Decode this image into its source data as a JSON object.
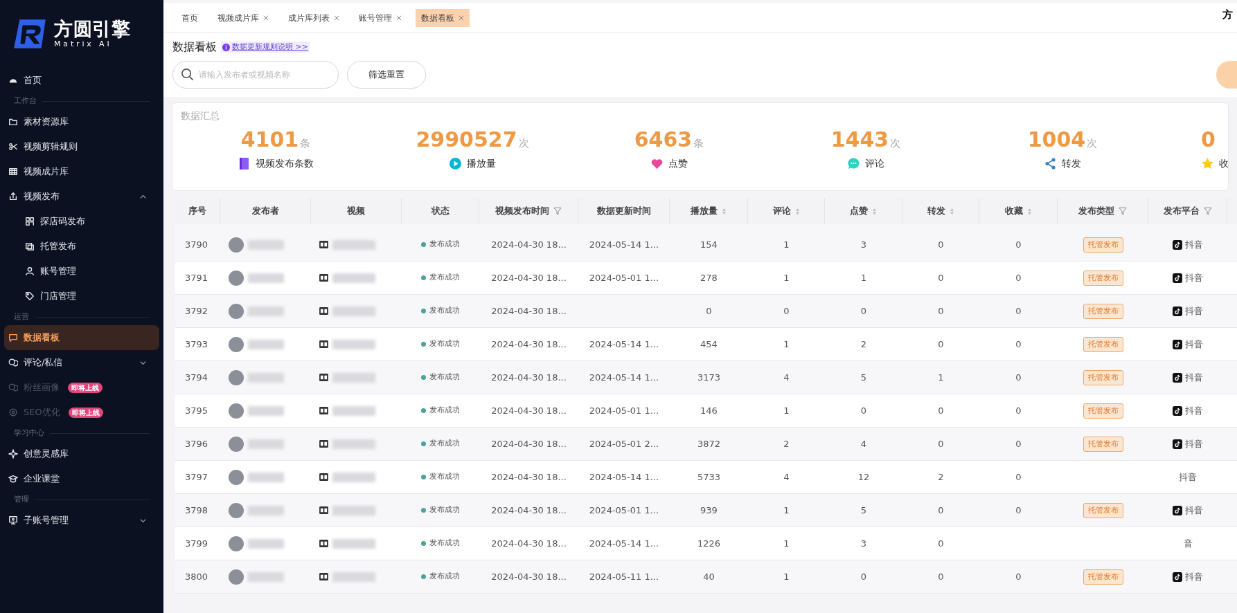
{
  "sidebar": {
    "logo": {
      "title": "方圆引擎",
      "subtitle": "Matrix AI"
    },
    "items": [
      {
        "kind": "item",
        "label": "首页",
        "selected": false,
        "disabled": false
      },
      {
        "kind": "section",
        "label": "工作台"
      },
      {
        "kind": "item",
        "label": "素材资源库",
        "selected": false,
        "disabled": false
      },
      {
        "kind": "item",
        "label": "视频剪辑规则",
        "selected": false,
        "disabled": false
      },
      {
        "kind": "item",
        "label": "视频成片库",
        "selected": false,
        "disabled": false
      },
      {
        "kind": "item",
        "label": "视频发布",
        "selected": false,
        "disabled": false,
        "expanded": true,
        "children": [
          {
            "kind": "item",
            "label": "探店码发布",
            "selected": false,
            "disabled": false
          },
          {
            "kind": "item",
            "label": "托管发布",
            "selected": false,
            "disabled": false
          },
          {
            "kind": "item",
            "label": "账号管理",
            "selected": false,
            "disabled": false
          },
          {
            "kind": "item",
            "label": "门店管理",
            "selected": false,
            "disabled": false
          }
        ]
      },
      {
        "kind": "section",
        "label": "运营"
      },
      {
        "kind": "item",
        "label": "数据看板",
        "selected": true,
        "disabled": false
      },
      {
        "kind": "item",
        "label": "评论/私信",
        "selected": false,
        "disabled": false,
        "expanded": false
      },
      {
        "kind": "item",
        "label": "粉丝画像",
        "selected": false,
        "disabled": true,
        "badge": "即将上线"
      },
      {
        "kind": "item",
        "label": "SEO优化",
        "selected": false,
        "disabled": true,
        "badge": "即将上线"
      },
      {
        "kind": "section",
        "label": "学习中心"
      },
      {
        "kind": "item",
        "label": "创意灵感库",
        "selected": false,
        "disabled": false
      },
      {
        "kind": "item",
        "label": "企业课堂",
        "selected": false,
        "disabled": false
      },
      {
        "kind": "section",
        "label": "管理"
      },
      {
        "kind": "item",
        "label": "子账号管理",
        "selected": false,
        "disabled": false,
        "expanded": false
      }
    ]
  },
  "tabs": [
    {
      "label": "首页",
      "closable": false,
      "selected": false
    },
    {
      "label": "视频成片库",
      "closable": true,
      "selected": false
    },
    {
      "label": "成片库列表",
      "closable": true,
      "selected": false
    },
    {
      "label": "账号管理",
      "closable": true,
      "selected": false
    },
    {
      "label": "数据看板",
      "closable": true,
      "selected": true
    }
  ],
  "user": "方",
  "page": {
    "title": "数据看板",
    "help_link": "数据更新规则说明 >>"
  },
  "search": {
    "placeholder": "请输入发布者或视频名称"
  },
  "reset_button": "筛选重置",
  "summary": {
    "title": "数据汇总",
    "stats": [
      {
        "value": "4101",
        "unit": "条",
        "label": "视频发布条数"
      },
      {
        "value": "2990527",
        "unit": "次",
        "label": "播放量"
      },
      {
        "value": "6463",
        "unit": "条",
        "label": "点赞"
      },
      {
        "value": "1443",
        "unit": "次",
        "label": "评论"
      },
      {
        "value": "1004",
        "unit": "次",
        "label": "转发"
      },
      {
        "value": "0",
        "label": "收"
      }
    ]
  },
  "table": {
    "columns": [
      {
        "label": "序号",
        "kind": "plain"
      },
      {
        "label": "发布者",
        "kind": "plain"
      },
      {
        "label": "视频",
        "kind": "plain"
      },
      {
        "label": "状态",
        "kind": "plain"
      },
      {
        "label": "视频发布时间",
        "kind": "filter"
      },
      {
        "label": "数据更新时间",
        "kind": "plain"
      },
      {
        "label": "播放量",
        "kind": "sort"
      },
      {
        "label": "评论",
        "kind": "sort"
      },
      {
        "label": "点赞",
        "kind": "sort"
      },
      {
        "label": "转发",
        "kind": "sort"
      },
      {
        "label": "收藏",
        "kind": "sort"
      },
      {
        "label": "发布类型",
        "kind": "filter"
      },
      {
        "label": "发布平台",
        "kind": "filter"
      }
    ],
    "rows": [
      {
        "no": "3790",
        "status": "发布成功",
        "publish_time": "2024-04-30 18...",
        "update_time": "2024-05-14 1...",
        "plays": "154",
        "comments": "1",
        "likes": "3",
        "shares": "0",
        "favorites": "0",
        "type": "托管发布",
        "platform": "抖音",
        "platform_icon": true
      },
      {
        "no": "3791",
        "status": "发布成功",
        "publish_time": "2024-04-30 18...",
        "update_time": "2024-05-01 1...",
        "plays": "278",
        "comments": "1",
        "likes": "1",
        "shares": "0",
        "favorites": "0",
        "type": "托管发布",
        "platform": "抖音",
        "platform_icon": true
      },
      {
        "no": "3792",
        "status": "发布成功",
        "publish_time": "2024-04-30 18...",
        "plays": "0",
        "comments": "0",
        "likes": "0",
        "shares": "0",
        "favorites": "0",
        "type": "托管发布",
        "platform": "抖音",
        "platform_icon": true
      },
      {
        "no": "3793",
        "status": "发布成功",
        "publish_time": "2024-04-30 18...",
        "update_time": "2024-05-14 1...",
        "plays": "454",
        "comments": "1",
        "likes": "2",
        "shares": "0",
        "favorites": "0",
        "type": "托管发布",
        "platform": "抖音",
        "platform_icon": true
      },
      {
        "no": "3794",
        "status": "发布成功",
        "publish_time": "2024-04-30 18...",
        "update_time": "2024-05-14 1...",
        "plays": "3173",
        "comments": "4",
        "likes": "5",
        "shares": "1",
        "favorites": "0",
        "type": "托管发布",
        "platform": "抖音",
        "platform_icon": true
      },
      {
        "no": "3795",
        "status": "发布成功",
        "publish_time": "2024-04-30 18...",
        "update_time": "2024-05-01 1...",
        "plays": "146",
        "comments": "1",
        "likes": "0",
        "shares": "0",
        "favorites": "0",
        "type": "托管发布",
        "platform": "抖音",
        "platform_icon": true
      },
      {
        "no": "3796",
        "status": "发布成功",
        "publish_time": "2024-04-30 18...",
        "update_time": "2024-05-01 2...",
        "plays": "3872",
        "comments": "2",
        "likes": "4",
        "shares": "0",
        "favorites": "0",
        "type": "托管发布",
        "platform": "抖音",
        "platform_icon": true
      },
      {
        "no": "3797",
        "status": "发布成功",
        "publish_time": "2024-04-30 18...",
        "update_time": "2024-05-14 1...",
        "plays": "5733",
        "comments": "4",
        "likes": "12",
        "shares": "2",
        "favorites": "0",
        "platform": "抖音",
        "platform_icon": false
      },
      {
        "no": "3798",
        "status": "发布成功",
        "publish_time": "2024-04-30 18...",
        "update_time": "2024-05-01 1...",
        "plays": "939",
        "comments": "1",
        "likes": "5",
        "shares": "0",
        "favorites": "0",
        "type": "托管发布",
        "platform": "抖音",
        "platform_icon": true
      },
      {
        "no": "3799",
        "status": "发布成功",
        "publish_time": "2024-04-30 18...",
        "update_time": "2024-05-14 1...",
        "plays": "1226",
        "comments": "1",
        "likes": "3",
        "shares": "0",
        "platform": "音",
        "platform_icon": false
      },
      {
        "no": "3800",
        "status": "发布成功",
        "publish_time": "2024-04-30 18...",
        "update_time": "2024-05-11 1...",
        "plays": "40",
        "comments": "1",
        "likes": "0",
        "shares": "0",
        "favorites": "0",
        "type": "托管发布",
        "platform": "抖音",
        "platform_icon": true
      }
    ]
  }
}
